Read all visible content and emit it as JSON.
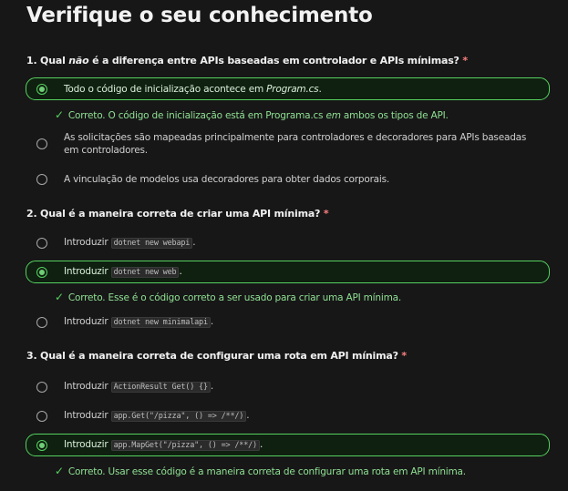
{
  "title": "Verifique o seu conhecimento",
  "required_mark": "*",
  "questions": [
    {
      "prefix": "1. Qual ",
      "emph": "não",
      "suffix": " é a diferença entre APIs baseadas em controlador e APIs mínimas?",
      "options": [
        {
          "text_before": "Todo o código de inicialização acontece em ",
          "italic": "Program.cs",
          "text_after": ".",
          "selected": true
        },
        {
          "text": "As solicitações são mapeadas principalmente para controladores e decoradores para APIs baseadas em controladores.",
          "selected": false
        },
        {
          "text": "A vinculação de modelos usa decoradores para obter dados corporais.",
          "selected": false
        }
      ],
      "feedback": {
        "before": "Correto. O código de inicialização está em Programa.cs ",
        "italic": "em",
        "after": " ambos os tipos de API."
      }
    },
    {
      "text": "2. Qual é a maneira correta de criar uma API mínima?",
      "options": [
        {
          "label": "Introduzir",
          "code": "dotnet new webapi",
          "end": ".",
          "selected": false
        },
        {
          "label": "Introduzir",
          "code": "dotnet new web",
          "end": ".",
          "selected": true
        },
        {
          "label": "Introduzir",
          "code": "dotnet new minimalapi",
          "end": ".",
          "selected": false
        }
      ],
      "feedback": {
        "text": "Correto. Esse é o código correto a ser usado para criar uma API mínima."
      }
    },
    {
      "text": "3. Qual é a maneira correta de configurar uma rota em API mínima?",
      "options": [
        {
          "label": "Introduzir",
          "code": "ActionResult Get() {}",
          "end": ".",
          "selected": false
        },
        {
          "label": "Introduzir",
          "code": "app.Get(\"/pizza\", () => /**/)",
          "end": ".",
          "selected": false
        },
        {
          "label": "Introduzir",
          "code": "app.MapGet(\"/pizza\", () => /**/)",
          "end": ".",
          "selected": true
        }
      ],
      "feedback": {
        "text": "Correto. Usar esse código é a maneira correta de configurar uma rota em API mínima."
      }
    }
  ],
  "icons": {
    "check": "checkmark-icon",
    "radio": "radio-icon"
  },
  "colors": {
    "background": "#171717",
    "accent": "#55d15f",
    "required": "#ff8080"
  }
}
